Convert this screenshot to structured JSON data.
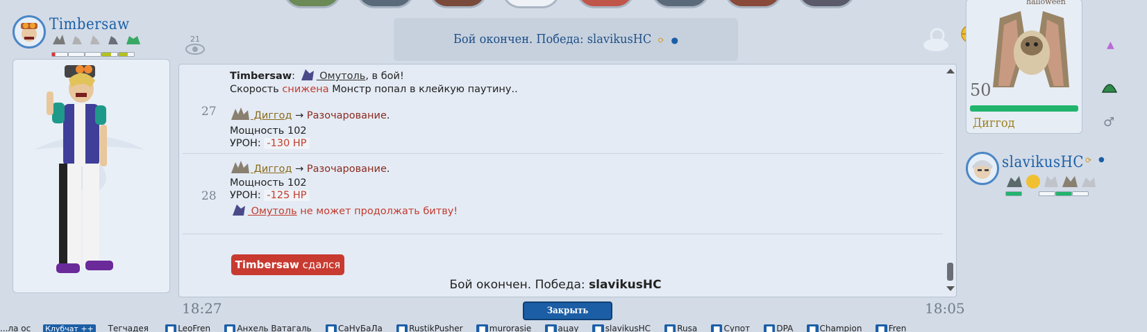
{
  "player_left": {
    "name": "Timbersaw",
    "spectators": "21"
  },
  "battle": {
    "banner_title": "Бой окончен. Победа: slavikusHC",
    "turns": [
      {
        "number": "27",
        "lines": {
          "intro_trainer": "Timbersaw",
          "intro_colon": ":",
          "intro_monster": " Омутоль",
          "intro_rest": ", в бой!",
          "speed_a": "Скорость ",
          "speed_b": "снижена",
          "speed_c": " Монстр попал в клейкую паутину..",
          "attacker": " Диггод",
          "arrow": " → ",
          "move": "Разочарование",
          "dot": ".",
          "power": "Мощность 102",
          "dmg_label": "УРОН: ",
          "dmg_value": " -130 HP"
        }
      },
      {
        "number": "28",
        "lines": {
          "attacker": " Диггод",
          "arrow": " → ",
          "move": "Разочарование",
          "dot": ".",
          "power": "Мощность 102",
          "dmg_label": "УРОН: ",
          "dmg_value": " -125 HP",
          "faint_monster": " Омутоль",
          "faint_rest": " не может продолжать битву!"
        }
      }
    ],
    "surrender_trainer": "Timbersaw",
    "surrender_text": " сдался",
    "end_text_prefix": "Бой окончен. Победа: ",
    "end_text_winner": "slavikusHC",
    "close_label": "Закрыть",
    "time_left": "18:27",
    "time_right": "18:05"
  },
  "opponent_monster": {
    "event_label": "halloween",
    "level": "50",
    "name": "Диггод",
    "gender_symbol": "♂",
    "hp_fraction": 1.0
  },
  "player_right": {
    "name": "slavikusHC"
  },
  "bottom_bar": {
    "items": [
      "...ла ос",
      "Клубчат ++",
      "Тегчадея",
      "LeoFren",
      "Анхель Ватагаль",
      "СаНуБаЛа",
      "RustikPusher",
      "murorasie",
      "ацау",
      "slavikusHC",
      "Rusa",
      "Супот",
      "DPA",
      "Champion",
      "Fren"
    ]
  },
  "colors": {
    "accent_blue": "#1b5fa6",
    "hp_green": "#21b46d",
    "surrender_red": "#c83a30",
    "damage_red": "#c23b2e"
  }
}
